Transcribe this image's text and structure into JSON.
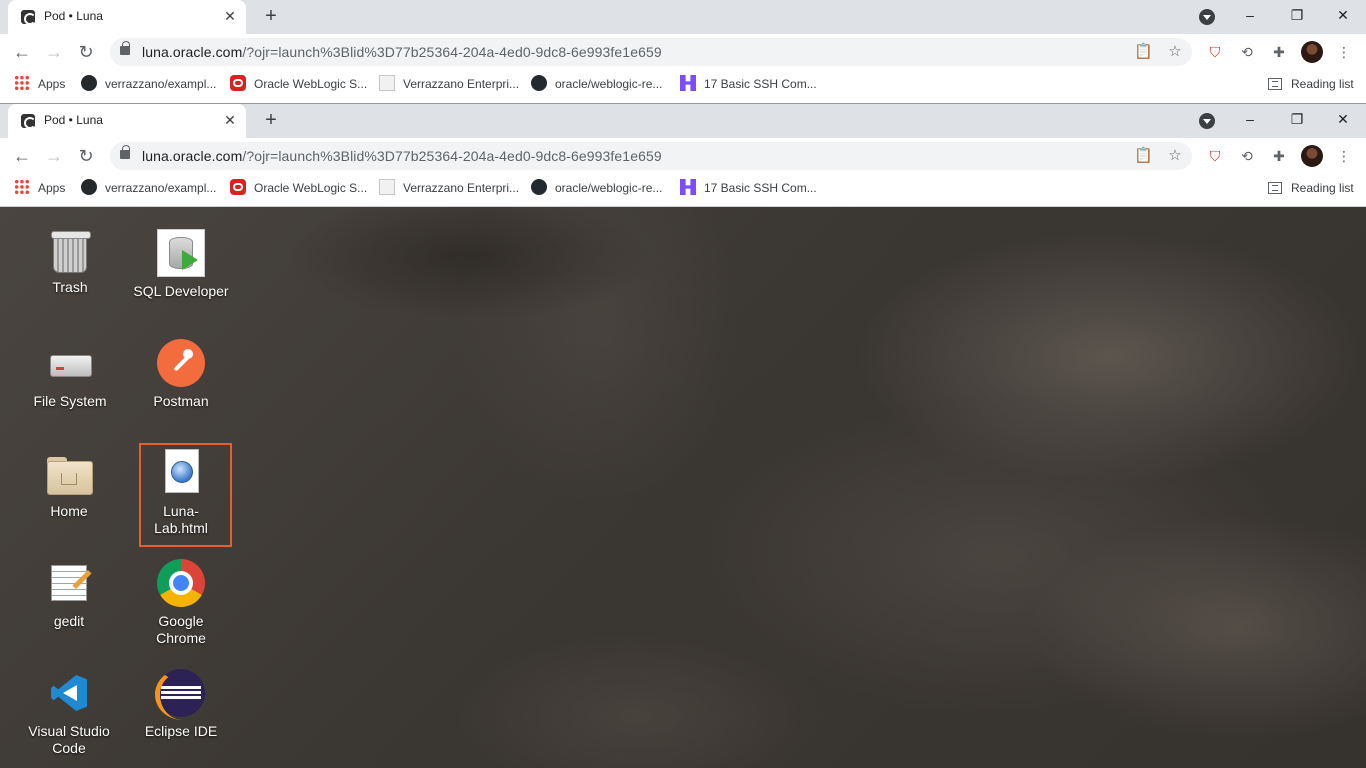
{
  "browser": {
    "tab_title": "Pod • Luna",
    "url_host": "luna.oracle.com",
    "url_path": "/?ojr=launch%3Blid%3D77b25364-204a-4ed0-9dc8-6e993fe1e659",
    "bookmarks": [
      {
        "label": "Apps",
        "icon": "apps-grid-icon"
      },
      {
        "label": "verrazzano/exampl...",
        "icon": "github-icon"
      },
      {
        "label": "Oracle WebLogic S...",
        "icon": "oracle-icon"
      },
      {
        "label": "Verrazzano Enterpri...",
        "icon": "document-icon"
      },
      {
        "label": "oracle/weblogic-re...",
        "icon": "github-icon"
      },
      {
        "label": "17 Basic SSH Com...",
        "icon": "hostinger-icon"
      }
    ],
    "reading_list": "Reading list",
    "window_controls": {
      "minimize": "–",
      "restore": "❐",
      "close": "✕"
    }
  },
  "desktop": {
    "icons": [
      {
        "label": "Trash",
        "icon": "trash-icon"
      },
      {
        "label": "SQL Developer",
        "icon": "sql-developer-icon"
      },
      {
        "label": "File System",
        "icon": "drive-icon"
      },
      {
        "label": "Postman",
        "icon": "postman-icon"
      },
      {
        "label": "Home",
        "icon": "home-folder-icon"
      },
      {
        "label": "Luna-Lab.html",
        "icon": "html-file-icon",
        "selected": true
      },
      {
        "label": "gedit",
        "icon": "text-editor-icon"
      },
      {
        "label": "Google Chrome",
        "icon": "chrome-icon"
      },
      {
        "label": "Visual Studio Code",
        "icon": "vscode-icon"
      },
      {
        "label": "Eclipse IDE",
        "icon": "eclipse-icon"
      }
    ],
    "highlight_color": "#e5602a"
  }
}
